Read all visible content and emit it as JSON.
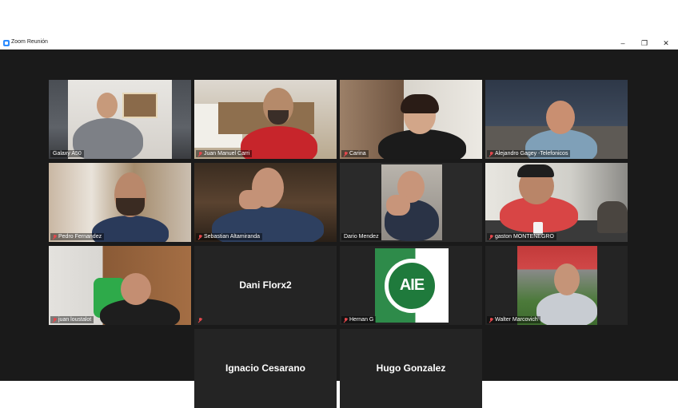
{
  "window": {
    "title": "Zoom Reunión",
    "controls": {
      "minimize": "–",
      "maximize": "❐",
      "close": "✕"
    }
  },
  "participants": [
    {
      "name": "Galaxy A50",
      "muted": false,
      "video": true
    },
    {
      "name": "Juan Manuel Carri",
      "muted": true,
      "video": true
    },
    {
      "name": "Carina",
      "muted": true,
      "video": true
    },
    {
      "name": "Alejandro Gagey -Telefonicos",
      "muted": true,
      "video": true
    },
    {
      "name": "Pedro Fernandez",
      "muted": true,
      "video": true
    },
    {
      "name": "Sebastian Altamiranda",
      "muted": true,
      "video": true
    },
    {
      "name": "Dario Mendez",
      "muted": false,
      "video": true,
      "active_speaker": true
    },
    {
      "name": "gaston MONTENEGRO",
      "muted": true,
      "video": true
    },
    {
      "name": "juan loustalot",
      "muted": true,
      "video": true
    },
    {
      "name": "Dani Florx2",
      "muted": true,
      "video": false
    },
    {
      "name": "Hernan G",
      "muted": true,
      "video": true
    },
    {
      "name": "Walter Marcovich",
      "muted": true,
      "video": true
    },
    {
      "name": "Ignacio Cesarano",
      "muted": false,
      "video": false
    },
    {
      "name": "Hugo Gonzalez",
      "muted": false,
      "video": false
    }
  ],
  "colors": {
    "active_border": "#c7d94a",
    "tile_bg": "#242424",
    "stage_bg": "#1a1a1a",
    "muted_icon": "#e5484d"
  },
  "logo": {
    "text": "AIE"
  }
}
